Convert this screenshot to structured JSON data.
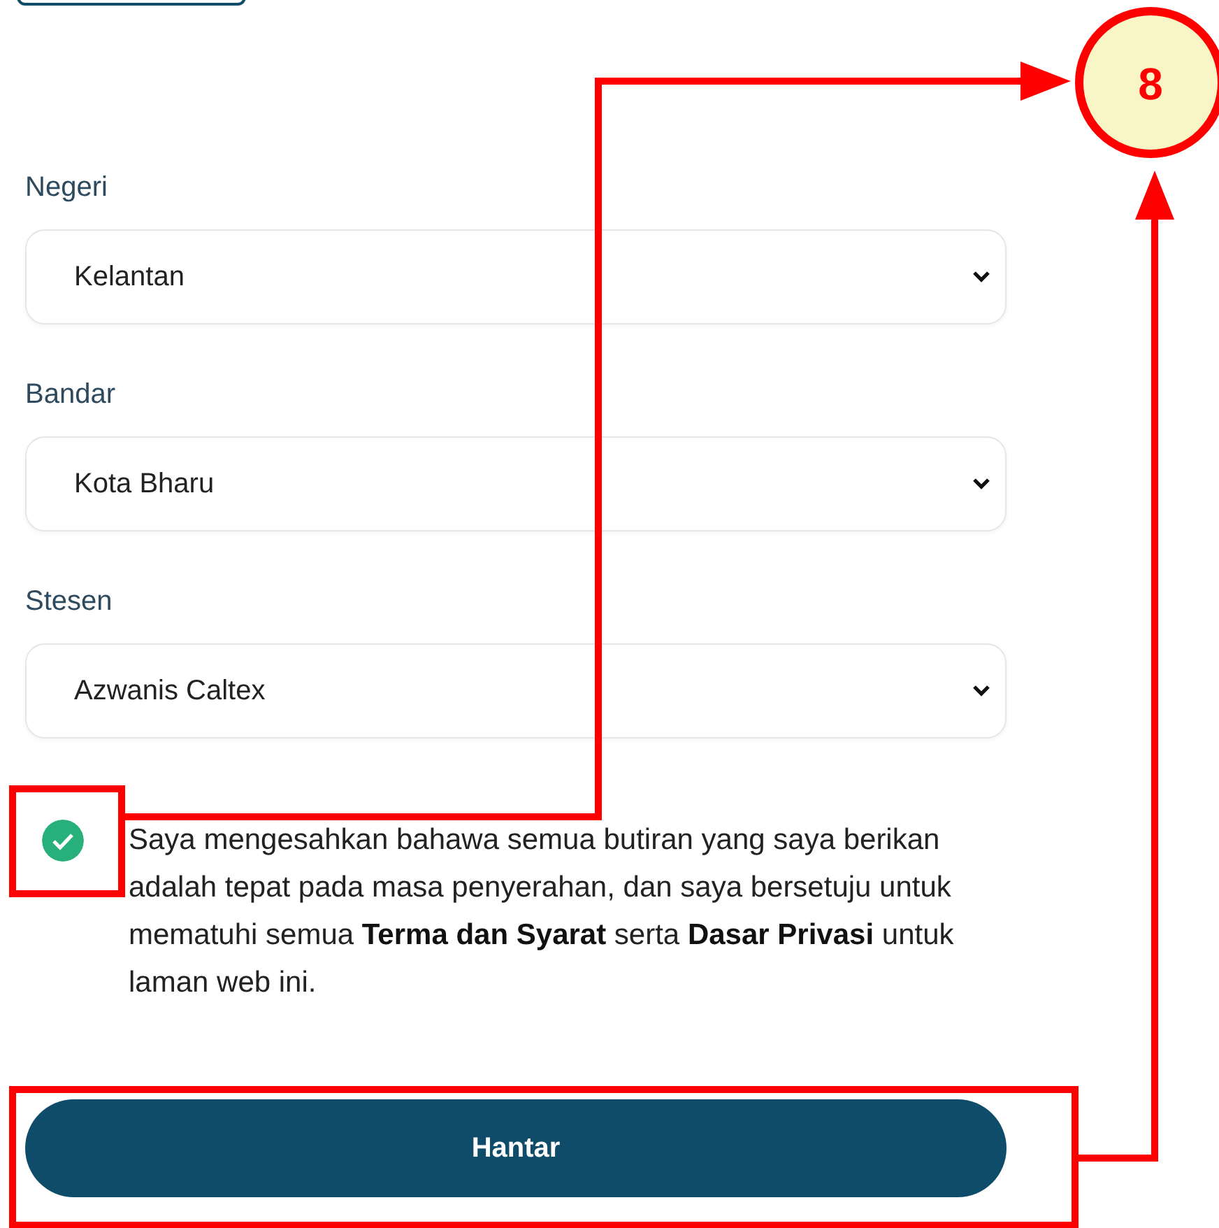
{
  "fields": [
    {
      "label": "Negeri",
      "value": "Kelantan"
    },
    {
      "label": "Bandar",
      "value": "Kota Bharu"
    },
    {
      "label": "Stesen",
      "value": "Azwanis Caltex"
    }
  ],
  "agreement": {
    "checked": true,
    "text": "Saya mengesahkan bahawa semua butiran yang saya berikan adalah tepat pada masa penyerahan, dan saya bersetuju untuk mematuhi semua **Terma dan Syarat** serta **Dasar Privasi** untuk laman web ini."
  },
  "submit_button": {
    "label": "Hantar"
  },
  "annotation": {
    "number": "8"
  }
}
